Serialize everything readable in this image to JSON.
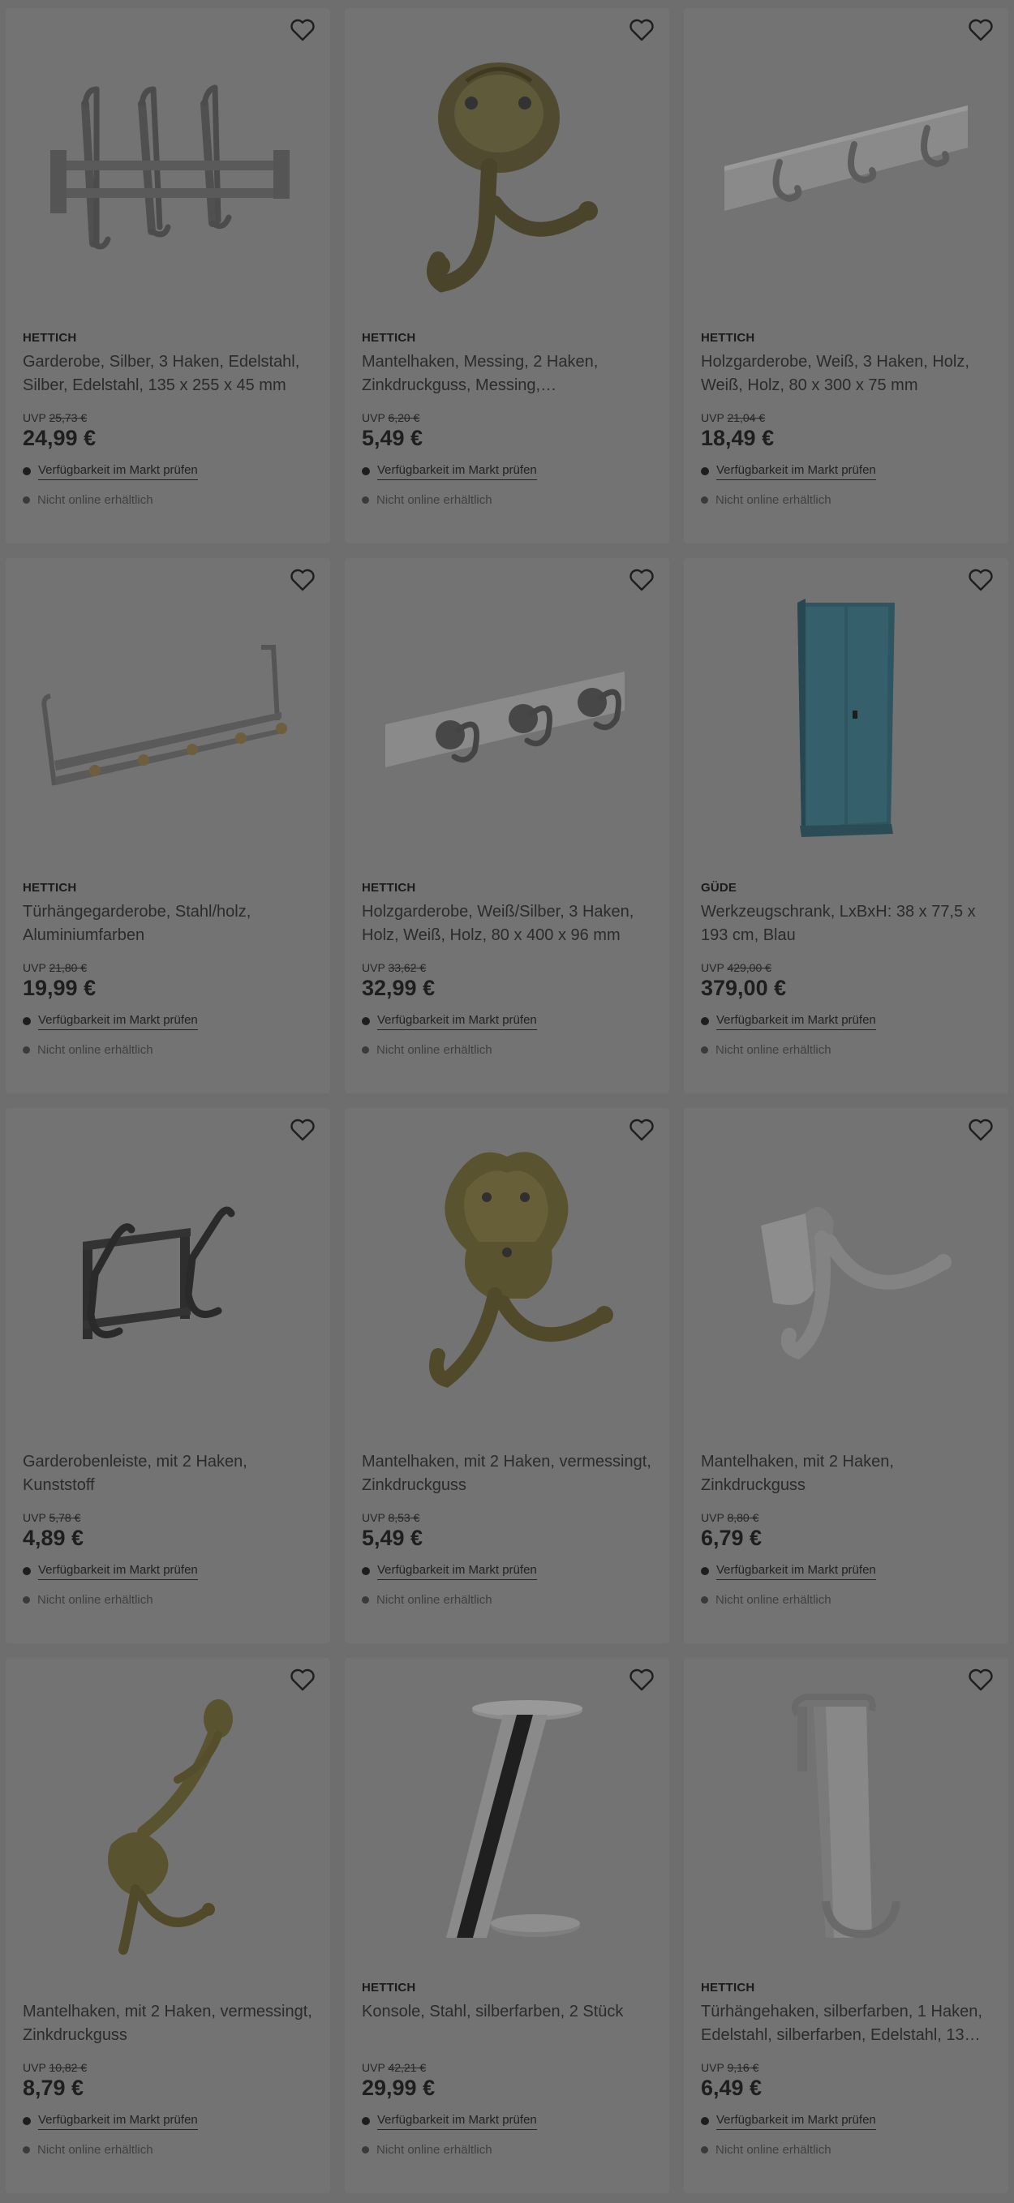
{
  "uvp_label": "UVP",
  "availability_link": "Verfügbarkeit im Markt prüfen",
  "online_status": "Nicht online erhältlich",
  "products": [
    {
      "brand": "HETTICH",
      "title": "Garderobe, Silber, 3 Haken, Edelstahl, Silber, Edelstahl, 135 x 255 x 45 mm",
      "old_price": "25,73 €",
      "price": "24,99 €",
      "image_icon": "coat-rack-3-hooks-steel"
    },
    {
      "brand": "HETTICH",
      "title": "Mantelhaken, Messing, 2 Haken, Zinkdruckguss, Messing,…",
      "old_price": "6,20 €",
      "price": "5,49 €",
      "image_icon": "ornate-brass-double-hook"
    },
    {
      "brand": "HETTICH",
      "title": "Holzgarderobe, Weiß, 3 Haken, Holz, Weiß, Holz, 80 x 300 x 75 mm",
      "old_price": "21,04 €",
      "price": "18,49 €",
      "image_icon": "white-wooden-coat-rack"
    },
    {
      "brand": "HETTICH",
      "title": "Türhängegarderobe, Stahl/holz, Aluminiumfarben",
      "old_price": "21,80 €",
      "price": "19,99 €",
      "image_icon": "over-door-hanger-rack"
    },
    {
      "brand": "HETTICH",
      "title": "Holzgarderobe, Weiß/Silber, 3 Haken, Holz, Weiß, Holz, 80 x 400 x 96 mm",
      "old_price": "33,62 €",
      "price": "32,99 €",
      "image_icon": "white-rack-silver-hooks"
    },
    {
      "brand": "GÜDE",
      "title": "Werkzeugschrank, LxBxH: 38 x 77,5 x 193 cm, Blau",
      "old_price": "429,00 €",
      "price": "379,00 €",
      "image_icon": "blue-tool-cabinet"
    },
    {
      "brand": "",
      "title": "Garderobenleiste, mit 2 Haken, Kunststoff",
      "old_price": "5,78 €",
      "price": "4,89 €",
      "image_icon": "black-2-hook-rail"
    },
    {
      "brand": "",
      "title": "Mantelhaken, mit 2 Haken, vermessingt, Zinkdruckguss",
      "old_price": "8,53 €",
      "price": "5,49 €",
      "image_icon": "ornate-brass-hook"
    },
    {
      "brand": "",
      "title": "Mantelhaken, mit 2 Haken, Zinkdruckguss",
      "old_price": "8,80 €",
      "price": "6,79 €",
      "image_icon": "white-double-hook"
    },
    {
      "brand": "",
      "title": "Mantelhaken, mit 2 Haken, vermessingt, Zinkdruckguss",
      "old_price": "10,82 €",
      "price": "8,79 €",
      "image_icon": "brass-tall-double-hook"
    },
    {
      "brand": "HETTICH",
      "title": "Konsole, Stahl, silberfarben, 2 Stück",
      "old_price": "42,21 €",
      "price": "29,99 €",
      "image_icon": "chrome-angled-bracket"
    },
    {
      "brand": "HETTICH",
      "title": "Türhängehaken, silberfarben, 1 Haken, Edelstahl, silberfarben, Edelstahl, 13…",
      "old_price": "9,16 €",
      "price": "6,49 €",
      "image_icon": "steel-door-hook"
    }
  ]
}
